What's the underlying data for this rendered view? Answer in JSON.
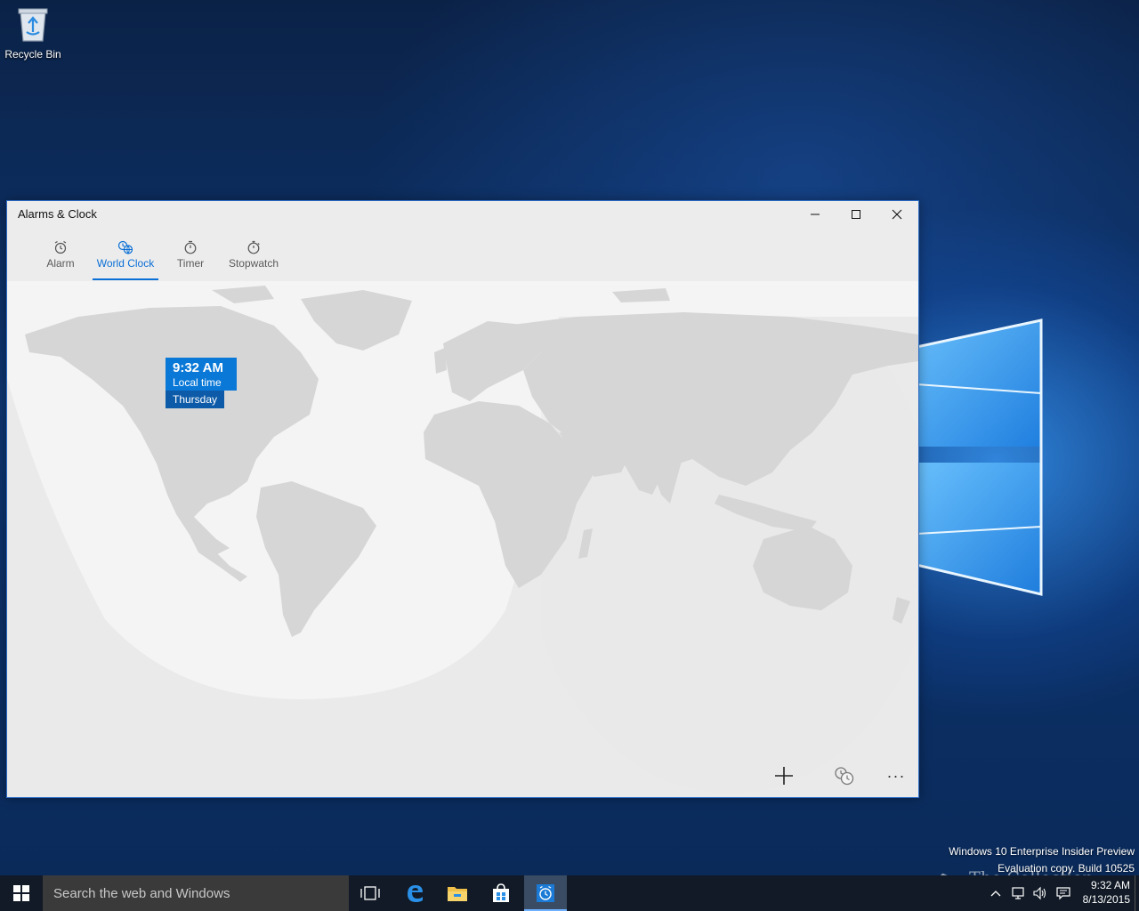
{
  "desktop": {
    "recycle_bin_label": "Recycle Bin"
  },
  "window": {
    "title": "Alarms & Clock",
    "accent_color": "#0a78d7"
  },
  "tabs": [
    {
      "label": "Alarm",
      "icon": "alarm-clock-icon",
      "active": false
    },
    {
      "label": "World Clock",
      "icon": "world-clock-icon",
      "active": true
    },
    {
      "label": "Timer",
      "icon": "timer-icon",
      "active": false
    },
    {
      "label": "Stopwatch",
      "icon": "stopwatch-icon",
      "active": false
    }
  ],
  "clock_pin": {
    "time": "9:32 AM",
    "subtitle": "Local time",
    "day": "Thursday"
  },
  "commands": {
    "add": "add-icon",
    "compare": "compare-clocks-icon",
    "more": "···"
  },
  "watermark": {
    "line1": "Windows 10 Enterprise Insider Preview",
    "line2": "Evaluation copy. Build 10525",
    "brand": "The Collection Book"
  },
  "taskbar": {
    "search_placeholder": "Search the web and Windows",
    "clock_time": "9:32 AM",
    "clock_date": "8/13/2015"
  }
}
